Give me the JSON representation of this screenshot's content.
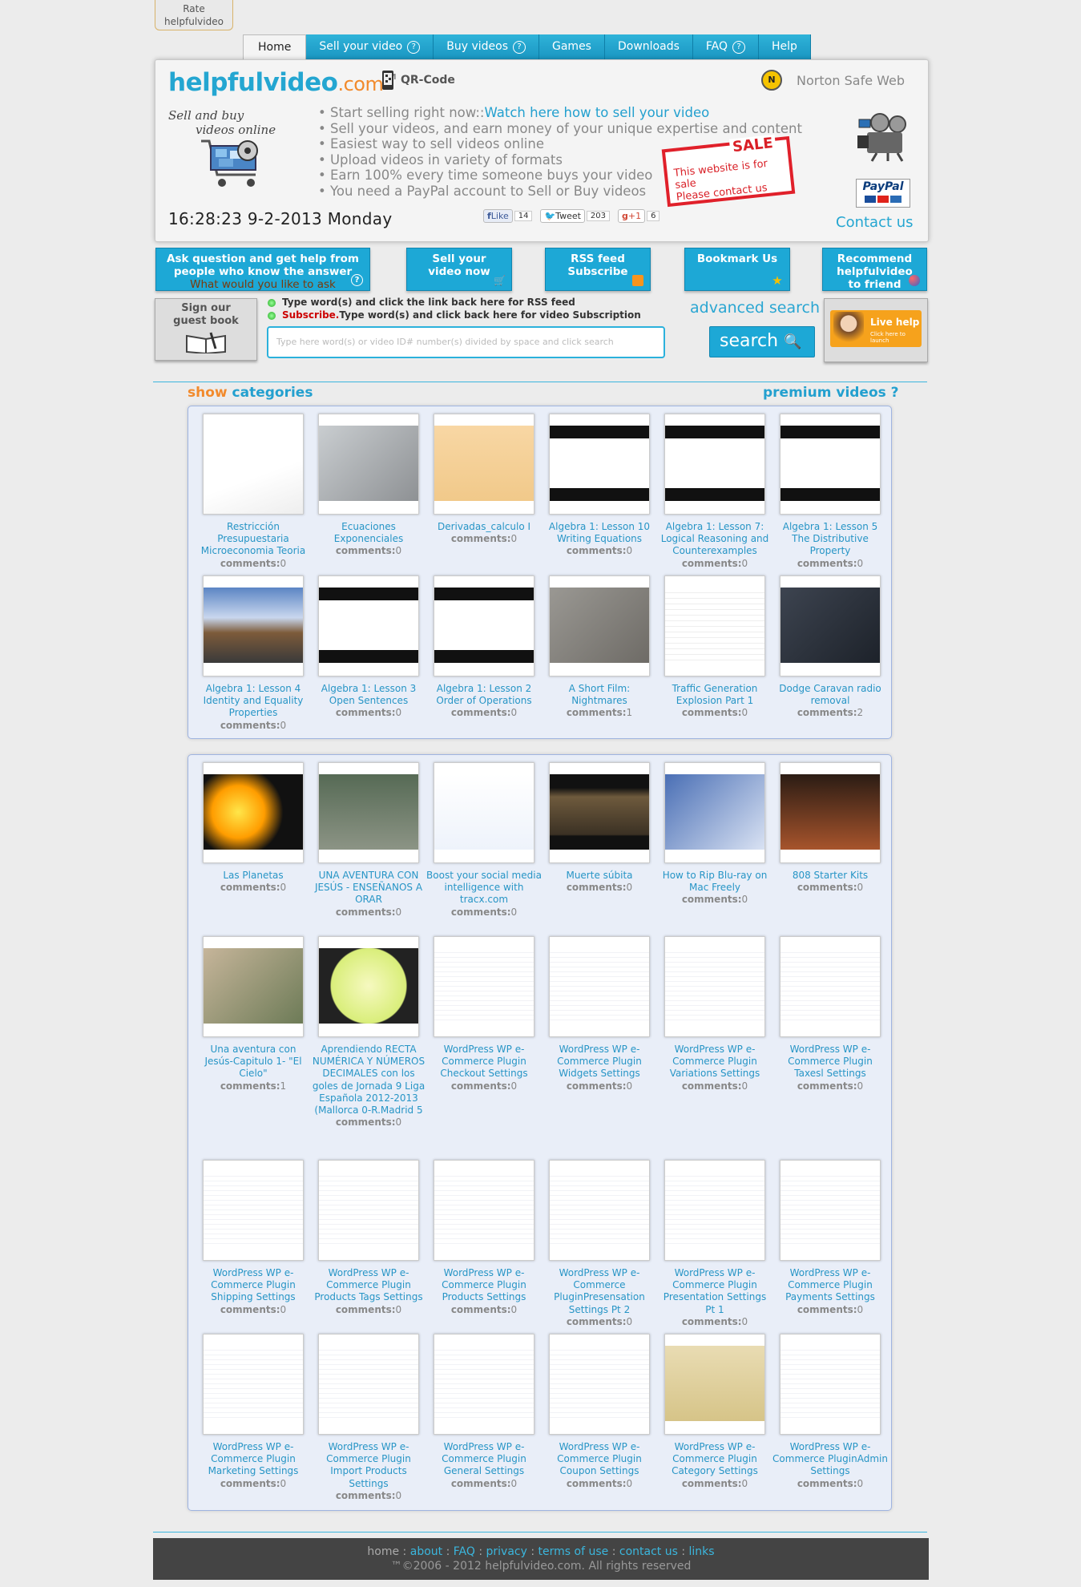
{
  "rate": {
    "line1": "Rate",
    "line2": "helpfulvideo"
  },
  "tabs": [
    {
      "label": "Home",
      "help": false
    },
    {
      "label": "Sell your video",
      "help": true
    },
    {
      "label": "Buy videos",
      "help": true
    },
    {
      "label": "Games",
      "help": false
    },
    {
      "label": "Downloads",
      "help": false
    },
    {
      "label": "FAQ",
      "help": true
    },
    {
      "label": "Help",
      "help": false
    }
  ],
  "header": {
    "logo_main": "helpfulvideo",
    "logo_com": ".com",
    "logo_tm": "TM",
    "qr_label": "QR-Code",
    "norton": "Norton Safe Web",
    "tagline1": "Sell and buy",
    "tagline2": "videos online",
    "bullets": [
      {
        "text": "Start selling right now::",
        "link": "Watch here how to sell your video"
      },
      {
        "text": "Sell your videos, and earn money of your unique expertise and content",
        "link": ""
      },
      {
        "text": "Easiest way to sell videos online",
        "link": ""
      },
      {
        "text": "Upload videos in variety of formats",
        "link": ""
      },
      {
        "text": "Earn 100% every time someone buys your video",
        "link": ""
      },
      {
        "text": "You need a PayPal account to Sell or Buy videos",
        "link": ""
      }
    ],
    "sale_title": "SALE",
    "sale_line1": "This website is for sale",
    "sale_line2": "Please contact us",
    "clock": "16:28:23  9-2-2013 Monday",
    "fb_label": "Like",
    "fb_count": "14",
    "tweet_label": "Tweet",
    "tweet_count": "203",
    "gplus_label": "+1",
    "gplus_count": "6",
    "paypal": "PayPal",
    "contact": "Contact us"
  },
  "actions": {
    "ask_line1": "Ask question and get help from",
    "ask_line2": "people who know the answer",
    "ask_sub": "What would you like to ask",
    "sell": "Sell your video now",
    "rss": "RSS feed Subscribe",
    "bookmark": "Bookmark Us",
    "recommend": "Recommend helpfulvideo to friend",
    "guest": "Sign our guest book",
    "rss_hint": "Type word(s) and click the link back here for RSS feed",
    "subscribe_word": "Subscribe.",
    "subscribe_hint": "Type word(s) and click back here for video Subscription",
    "search_placeholder": "Type here word(s) or video ID# number(s) divided by space and click search",
    "advanced": "advanced search",
    "search": "search",
    "live_help": "Live help",
    "live_sub": "Click here to launch"
  },
  "sections": {
    "show": "show",
    "categories": "categories",
    "premium": "premium videos ?"
  },
  "comments_label": "comments:",
  "premium_videos": [
    {
      "title": "Restricción Presupuestaria Microeconomia Teoria",
      "comments": "0"
    },
    {
      "title": "Ecuaciones Exponenciales",
      "comments": "0"
    },
    {
      "title": "Derivadas_calculo I",
      "comments": "0"
    },
    {
      "title": "Algebra 1: Lesson 10 Writing Equations",
      "comments": "0"
    },
    {
      "title": "Algebra 1: Lesson 7: Logical Reasoning and Counterexamples",
      "comments": "0"
    },
    {
      "title": "Algebra 1: Lesson 5 The Distributive Property",
      "comments": "0"
    },
    {
      "title": "Algebra 1: Lesson 4 Identity and Equality Properties",
      "comments": "0"
    },
    {
      "title": "Algebra 1: Lesson 3 Open Sentences",
      "comments": "0"
    },
    {
      "title": "Algebra 1: Lesson 2 Order of Operations",
      "comments": "0"
    },
    {
      "title": "A Short Film: Nightmares",
      "comments": "1"
    },
    {
      "title": "Traffic Generation Explosion Part 1",
      "comments": "0"
    },
    {
      "title": "Dodge Caravan radio removal",
      "comments": "2"
    }
  ],
  "videos": [
    {
      "title": "Las Planetas",
      "comments": "0"
    },
    {
      "title": "UNA AVENTURA CON JESÚS - ENSEÑANOS A ORAR",
      "comments": "0"
    },
    {
      "title": "Boost your social media intelligence with tracx.com",
      "comments": "0"
    },
    {
      "title": "Muerte súbita",
      "comments": "0"
    },
    {
      "title": "How to Rip Blu-ray on Mac Freely",
      "comments": "0"
    },
    {
      "title": "808 Starter Kits",
      "comments": "0"
    },
    {
      "title": "Una aventura con Jesús-Capitulo 1- \"El Cielo\"",
      "comments": "1"
    },
    {
      "title": "Aprendiendo RECTA NUMÉRICA Y NÚMEROS DECIMALES con los goles de Jornada 9 Liga Española 2012-2013 (Mallorca 0-R.Madrid 5",
      "comments": "0"
    },
    {
      "title": "WordPress WP e-Commerce Plugin Checkout Settings",
      "comments": "0"
    },
    {
      "title": "WordPress WP e-Commerce Plugin Widgets Settings",
      "comments": "0"
    },
    {
      "title": "WordPress WP e-Commerce Plugin Variations Settings",
      "comments": "0"
    },
    {
      "title": "WordPress WP e-Commerce Plugin Taxesl Settings",
      "comments": "0"
    },
    {
      "title": "WordPress WP e-Commerce Plugin Shipping Settings",
      "comments": "0"
    },
    {
      "title": "WordPress WP e-Commerce Plugin Products Tags Settings",
      "comments": "0"
    },
    {
      "title": "WordPress WP e-Commerce Plugin Products Settings",
      "comments": "0"
    },
    {
      "title": "WordPress WP e-Commerce PluginPresensation Settings Pt 2",
      "comments": "0"
    },
    {
      "title": "WordPress WP e-Commerce Plugin Presentation Settings Pt 1",
      "comments": "0"
    },
    {
      "title": "WordPress WP e-Commerce Plugin Payments Settings",
      "comments": "0"
    },
    {
      "title": "WordPress WP e-Commerce Plugin Marketing Settings",
      "comments": "0"
    },
    {
      "title": "WordPress WP e-Commerce Plugin Import Products Settings",
      "comments": "0"
    },
    {
      "title": "WordPress WP e-Commerce Plugin General Settings",
      "comments": "0"
    },
    {
      "title": "WordPress WP e-Commerce Plugin Coupon Settings",
      "comments": "0"
    },
    {
      "title": "WordPress WP e-Commerce Plugin Category Settings",
      "comments": "0"
    },
    {
      "title": "WordPress WP e-Commerce PluginAdmin Settings",
      "comments": "0"
    }
  ],
  "footer": {
    "links": [
      "home",
      "about",
      "FAQ",
      "privacy",
      "terms of use",
      "contact us",
      "links"
    ],
    "copyright": "™©2006 - 2012 helpfulvideo.com. All rights reserved"
  }
}
